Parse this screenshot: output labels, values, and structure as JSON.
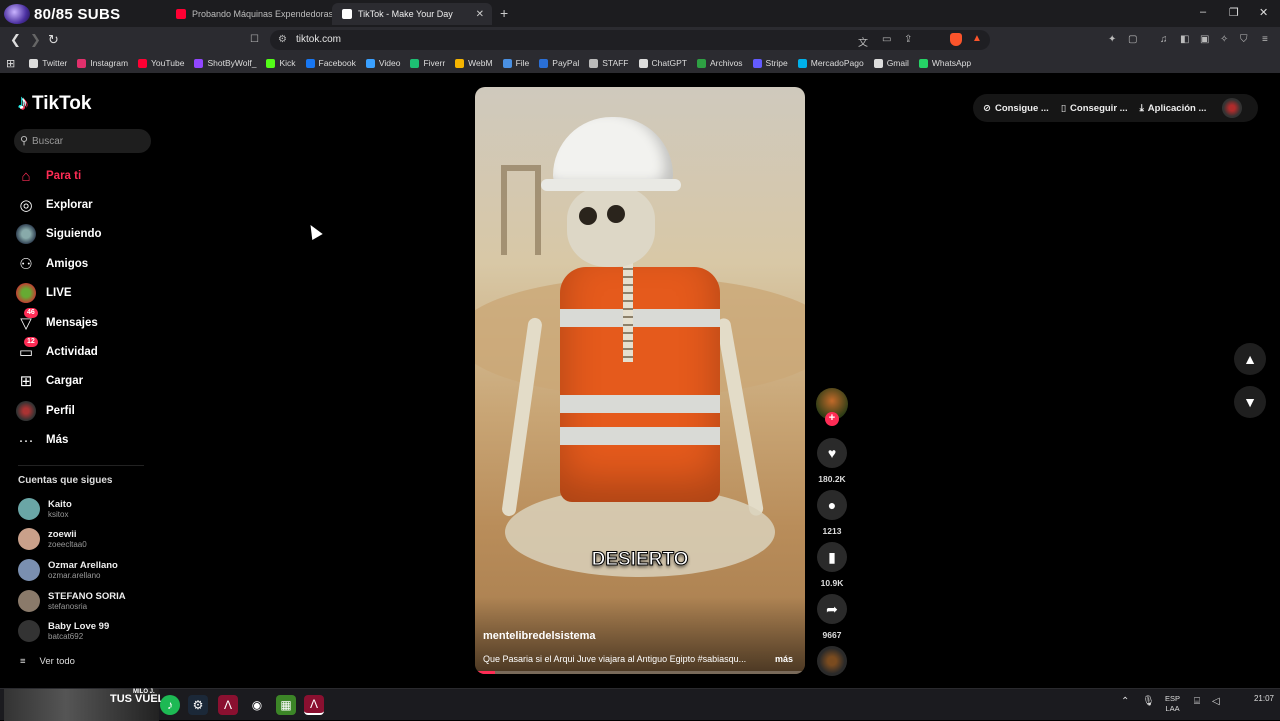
{
  "browser": {
    "overlay_subs": "80/85 SUBS",
    "tabs": [
      {
        "title": "Probando Máquinas Expendedoras",
        "favicon_color": "#ff0033"
      },
      {
        "title": "TikTok - Make Your Day",
        "favicon_color": "#ffffff",
        "active": true
      }
    ],
    "new_tab": "+",
    "url": "tiktok.com",
    "window_controls": [
      "–",
      "❐",
      "✕"
    ]
  },
  "bookmarks": [
    {
      "label": "Twitter",
      "color": "#dddddd"
    },
    {
      "label": "Instagram",
      "color": "#e1306c"
    },
    {
      "label": "YouTube",
      "color": "#ff0033"
    },
    {
      "label": "ShotByWolf_",
      "color": "#9146ff"
    },
    {
      "label": "Kick",
      "color": "#53fc18"
    },
    {
      "label": "Facebook",
      "color": "#1877f2"
    },
    {
      "label": "Video",
      "color": "#3aa0ff"
    },
    {
      "label": "Fiverr",
      "color": "#1dbf73"
    },
    {
      "label": "WebM",
      "color": "#f5b400"
    },
    {
      "label": "File",
      "color": "#4a90e2"
    },
    {
      "label": "PayPal",
      "color": "#2a6fd6"
    },
    {
      "label": "STAFF",
      "color": "#bbbbbb"
    },
    {
      "label": "ChatGPT",
      "color": "#dddddd"
    },
    {
      "label": "Archivos",
      "color": "#2ea043"
    },
    {
      "label": "Stripe",
      "color": "#635bff"
    },
    {
      "label": "MercadoPago",
      "color": "#00b1ea"
    },
    {
      "label": "Gmail",
      "color": "#dddddd"
    },
    {
      "label": "WhatsApp",
      "color": "#25d366"
    }
  ],
  "tiktok": {
    "logo": "TikTok",
    "search_placeholder": "Buscar",
    "nav": [
      {
        "label": "Para ti",
        "icon": "home-icon",
        "active": true
      },
      {
        "label": "Explorar",
        "icon": "compass-icon"
      },
      {
        "label": "Siguiendo",
        "icon": "avatar"
      },
      {
        "label": "Amigos",
        "icon": "friends-icon"
      },
      {
        "label": "LIVE",
        "icon": "live-avatar"
      },
      {
        "label": "Mensajes",
        "icon": "message-icon",
        "badge": "46"
      },
      {
        "label": "Actividad",
        "icon": "activity-icon",
        "badge": "12"
      },
      {
        "label": "Cargar",
        "icon": "upload-icon"
      },
      {
        "label": "Perfil",
        "icon": "profile-avatar"
      },
      {
        "label": "Más",
        "icon": "more-icon"
      }
    ],
    "following_title": "Cuentas que sigues",
    "following": [
      {
        "name": "Kaito",
        "handle": "ksitox",
        "color": "#6aa6a6"
      },
      {
        "name": "zoewii",
        "handle": "zoeecltaa0",
        "color": "#c9a08a"
      },
      {
        "name": "Ozmar Arellano",
        "handle": "ozmar.arellano",
        "color": "#7a8fb0"
      },
      {
        "name": "STEFANO SORIA",
        "handle": "stefanosria",
        "color": "#8a7a6a"
      },
      {
        "name": "Baby Love 99",
        "handle": "batcat692",
        "color": "#333333"
      }
    ],
    "see_all": "Ver todo",
    "top_right": [
      "Consigue ...",
      "Conseguir ...",
      "Aplicación ..."
    ],
    "accent": "#fe2c55"
  },
  "video": {
    "caption": "DESIERTO",
    "author": "mentelibredelsistema",
    "description": "Que Pasaria si el Arqui Juve viajara al Antiguo Egipto  #sabiasqu...",
    "more": "más",
    "progress": 0.06,
    "stats": {
      "likes": "180.2K",
      "comments": "1213",
      "saves": "10.9K",
      "shares": "9667"
    }
  },
  "taskbar": {
    "stream_text": "TUS VUEL",
    "stream_mini": "MILO J.",
    "lang": [
      "ESP",
      "LAA"
    ],
    "time": "21:07"
  }
}
